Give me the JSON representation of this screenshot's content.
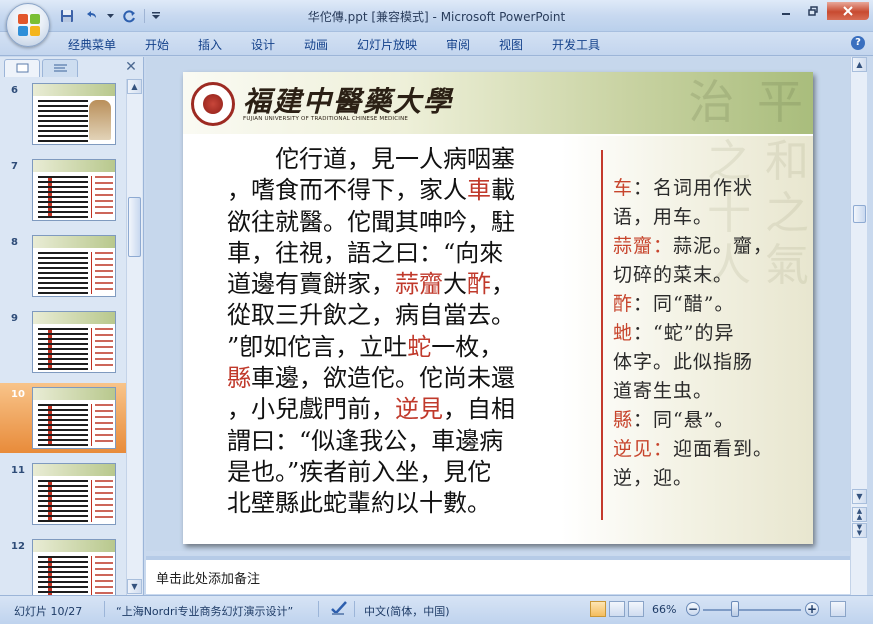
{
  "window": {
    "title": "华佗傳.ppt [兼容模式] - Microsoft PowerPoint"
  },
  "ribbon": {
    "tabs": [
      "经典菜单",
      "开始",
      "插入",
      "设计",
      "动画",
      "幻灯片放映",
      "审阅",
      "视图",
      "开发工具"
    ]
  },
  "slides_pane": {
    "thumbnails": [
      {
        "number": "6",
        "selected": false
      },
      {
        "number": "7",
        "selected": false
      },
      {
        "number": "8",
        "selected": false
      },
      {
        "number": "9",
        "selected": false
      },
      {
        "number": "10",
        "selected": true
      },
      {
        "number": "11",
        "selected": false
      },
      {
        "number": "12",
        "selected": false
      }
    ]
  },
  "slide": {
    "school_name": "福建中醫藥大學",
    "school_name_en": "FUJIAN UNIVERSITY OF TRADITIONAL CHINESE MEDICINE",
    "main_text": [
      [
        {
          "t": "　　佗行道，見一人病咽塞"
        }
      ],
      [
        {
          "t": "，嗜食而不得下，家人"
        },
        {
          "t": "車",
          "hl": true
        },
        {
          "t": "載"
        }
      ],
      [
        {
          "t": "欲往就醫。佗聞其呻吟，駐"
        }
      ],
      [
        {
          "t": "車，往視，語之曰：“向來"
        }
      ],
      [
        {
          "t": "道邊有賣餅家，"
        },
        {
          "t": "蒜齏",
          "hl": true
        },
        {
          "t": "大"
        },
        {
          "t": "酢",
          "hl": true
        },
        {
          "t": "，"
        }
      ],
      [
        {
          "t": "從取三升飲之，病自當去。"
        }
      ],
      [
        {
          "t": "”卽如佗言，立吐"
        },
        {
          "t": "蛇",
          "hl": true
        },
        {
          "t": "一枚，"
        }
      ],
      [
        {
          "t": "縣",
          "hl": true
        },
        {
          "t": "車邊，欲造佗。佗尚未還"
        }
      ],
      [
        {
          "t": "，小兒戲門前，"
        },
        {
          "t": "逆見",
          "hl": true
        },
        {
          "t": "，自相"
        }
      ],
      [
        {
          "t": "謂曰：“似逢我公，車邊病"
        }
      ],
      [
        {
          "t": "是也。”疾者前入坐，見佗"
        }
      ],
      [
        {
          "t": "北壁縣此蛇輩約以十數。"
        }
      ]
    ],
    "notes": [
      [
        {
          "t": "车",
          "k": true
        },
        {
          "t": "：名词用作状"
        }
      ],
      [
        {
          "t": "语，用车。"
        }
      ],
      [
        {
          "t": "蒜齏：",
          "k": true
        },
        {
          "t": "蒜泥。齏，"
        }
      ],
      [
        {
          "t": "切碎的菜末。"
        }
      ],
      [
        {
          "t": "酢",
          "k": true
        },
        {
          "t": "：同“醋”。"
        }
      ],
      [
        {
          "t": "虵",
          "k": true
        },
        {
          "t": "：“蛇”的异"
        }
      ],
      [
        {
          "t": "体字。此似指肠"
        }
      ],
      [
        {
          "t": "道寄生虫。"
        }
      ],
      [
        {
          "t": "縣",
          "k": true
        },
        {
          "t": "：同“悬”。"
        }
      ],
      [
        {
          "t": "逆见：",
          "k": true
        },
        {
          "t": "迎面看到。"
        }
      ],
      [
        {
          "t": "逆，迎。"
        }
      ]
    ]
  },
  "notes_pane": {
    "placeholder": "单击此处添加备注"
  },
  "status_bar": {
    "slide_info": "幻灯片 10/27",
    "theme": "“上海Nordri专业商务幻灯演示设计”",
    "language": "中文(简体，中国)",
    "zoom": "66%"
  },
  "colors": {
    "highlight": "#c0392b",
    "note_keyword": "#c7452d",
    "selected_thumb": "#e88b3a"
  }
}
